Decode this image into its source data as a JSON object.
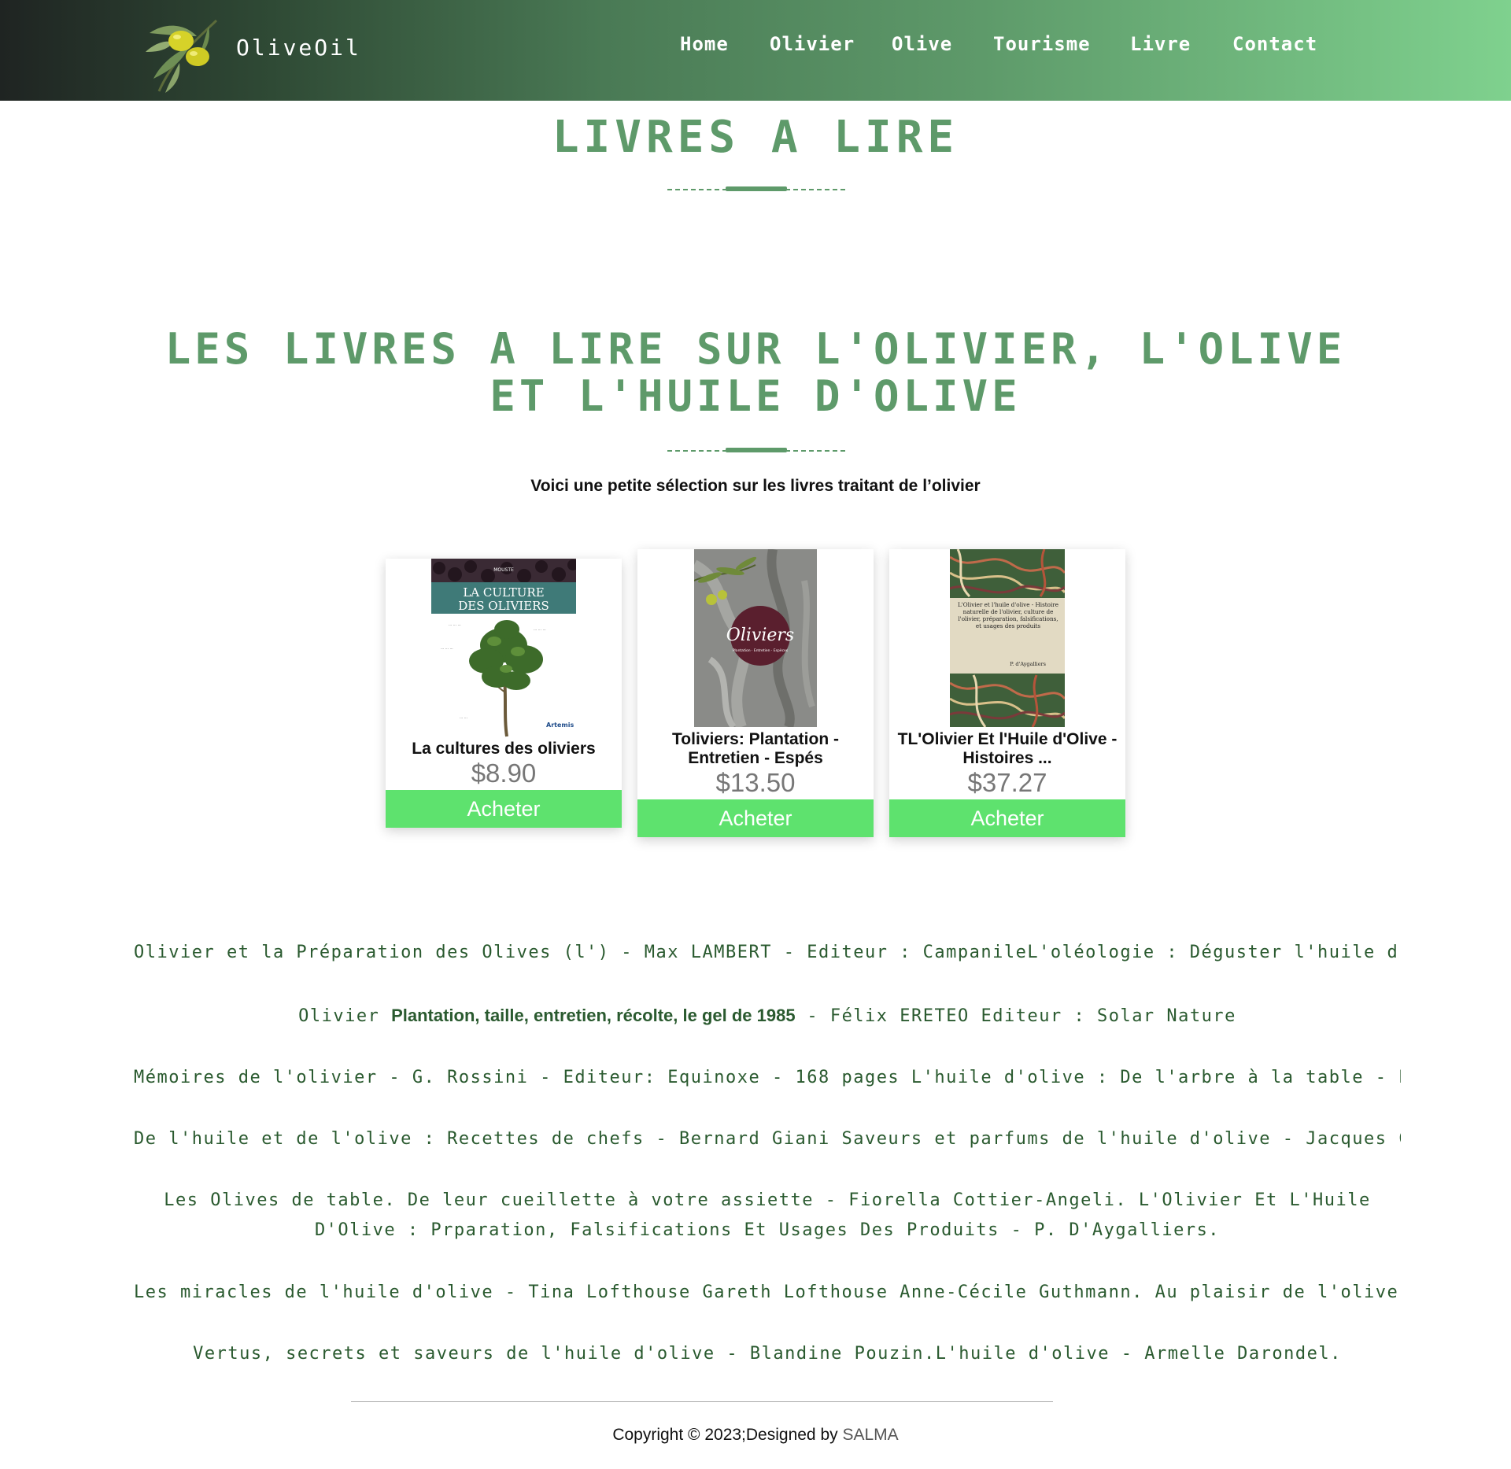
{
  "brand": "OliveOil",
  "nav": [
    {
      "label": "Home"
    },
    {
      "label": "Olivier"
    },
    {
      "label": "Olive"
    },
    {
      "label": "Tourisme"
    },
    {
      "label": "Livre"
    },
    {
      "label": "Contact"
    }
  ],
  "page_title": "LIVRES A LIRE",
  "section_title": "LES LIVRES A LIRE SUR L'OLIVIER, L'OLIVE ET L'HUILE D'OLIVE",
  "intro": "Voici une petite sélection sur les livres traitant de l’olivier",
  "books": [
    {
      "title": "La cultures des oliviers",
      "price": "$8.90",
      "buy_label": "Acheter",
      "cover": {
        "tag": "MOUSTE",
        "title_line1": "LA CULTURE",
        "title_line2": "DES OLIVIERS",
        "publisher": "Artemis"
      }
    },
    {
      "title": "Toliviers: Plantation - Entretien - Espés",
      "price": "$13.50",
      "buy_label": "Acheter",
      "cover": {
        "title": "Oliviers",
        "subtitle": "Plantation · Entretien · Espèces"
      }
    },
    {
      "title": "TL'Olivier Et l'Huile d'Olive - Histoires ...",
      "price": "$37.27",
      "buy_label": "Acheter",
      "cover": {
        "text": "L'Olivier et l'huile d'olive - Histoire naturelle de l'olivier, culture de l'olivier, préparation, falsifications, et usages des produits",
        "author": "P. d'Aygalliers"
      }
    }
  ],
  "booklist": {
    "l1": "Olivier et la Préparation des Olives (l') - Max LAMBERT - Editeur : CampanileL'oléologie : Déguster l'huile d'olive",
    "l2_a": "Olivier",
    "l2_b": "Plantation, taille, entretien, récolte, le gel de 1985",
    "l2_c": "- Félix ERETEO Editeur : Solar Nature",
    "l3": "Mémoires de l'olivier - G. Rossini - Editeur: Equinoxe - 168 pages L'huile d'olive : De l'arbre à la table - P. Ang",
    "l4": "De l'huile et de l'olive : Recettes de chefs - Bernard Giani Saveurs et parfums de l'huile d'olive - Jacques Chiboi",
    "l5": "Les Olives de table. De leur cueillette à votre assiette - Fiorella Cottier-Angeli. L'Olivier Et L'Huile D'Olive : Prparation, Falsifications Et Usages Des Produits - P. D'Aygalliers.",
    "l6": "Les miracles de l'huile d'olive - Tina Lofthouse Gareth Lofthouse Anne-Cécile Guthmann. Au plaisir de l'olive : His",
    "l7": "Vertus, secrets et saveurs de l'huile d'olive - Blandine Pouzin.L'huile d'olive - Armelle Darondel."
  },
  "footer": {
    "text": "Copyright © 2023;Designed by",
    "author": "SALMA"
  },
  "colors": {
    "accent": "#5e9a6a",
    "button": "#5ee26e",
    "header_dark": "#1f2422",
    "header_light": "#7fd18e"
  }
}
